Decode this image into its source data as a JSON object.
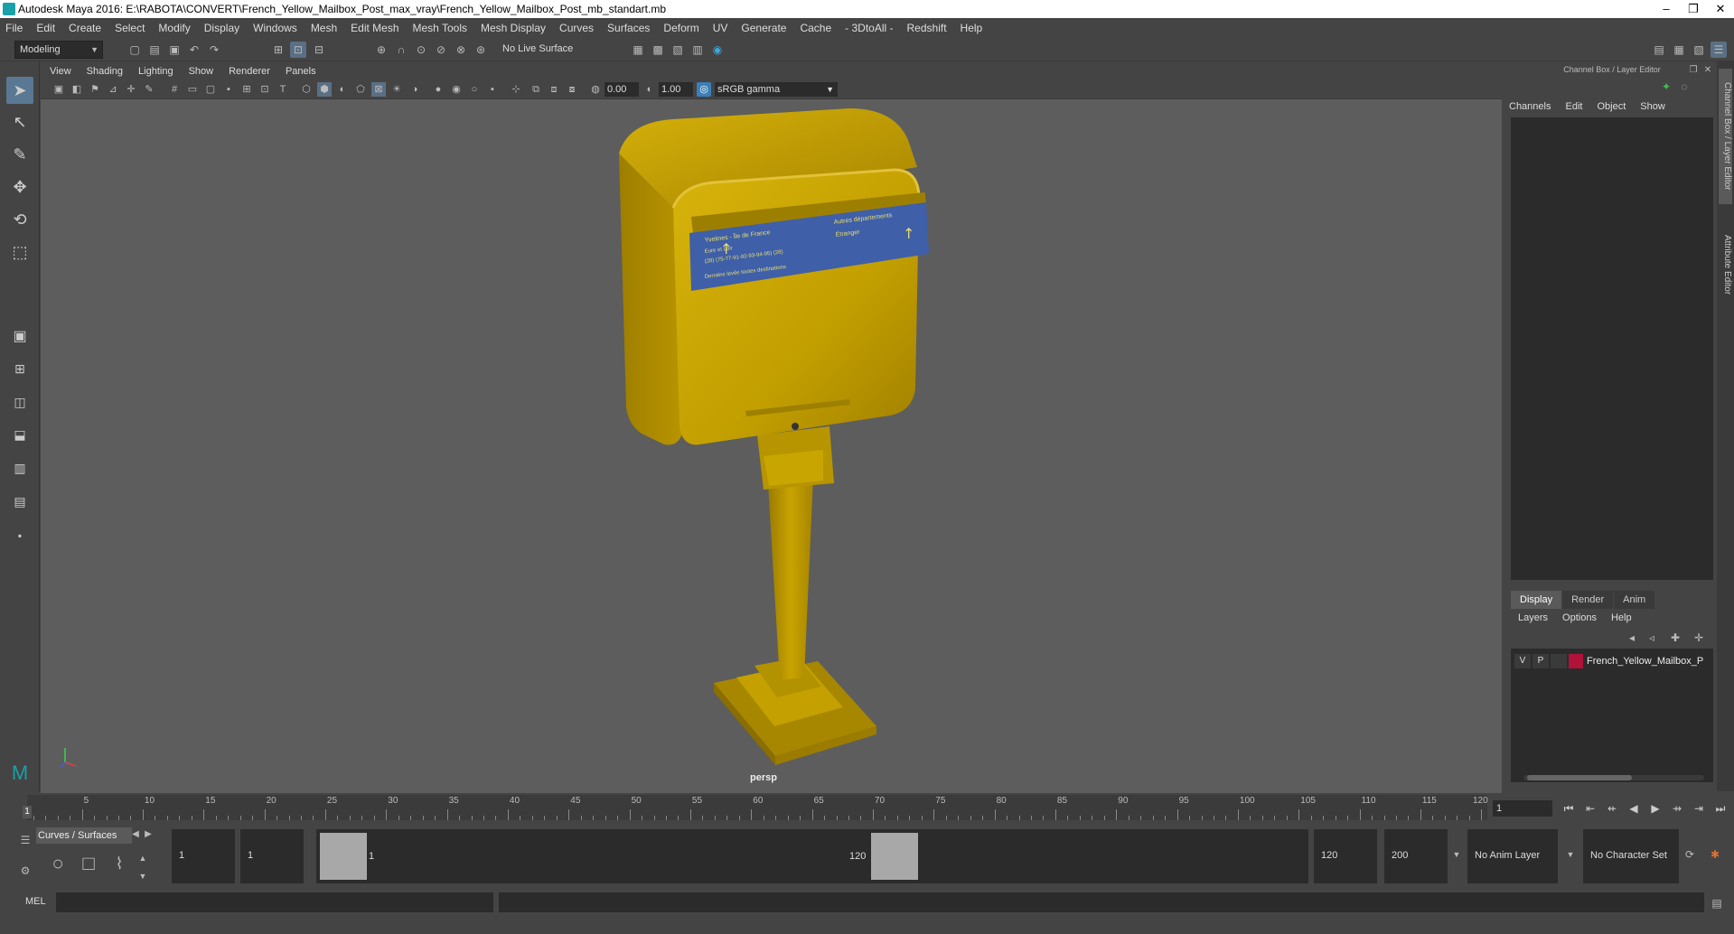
{
  "window": {
    "title": "Autodesk Maya 2016: E:\\RABOTA\\CONVERT\\French_Yellow_Mailbox_Post_max_vray\\French_Yellow_Mailbox_Post_mb_standart.mb",
    "minimize": "–",
    "maximize": "❐",
    "close": "✕"
  },
  "menubar": [
    "File",
    "Edit",
    "Create",
    "Select",
    "Modify",
    "Display",
    "Windows",
    "Mesh",
    "Edit Mesh",
    "Mesh Tools",
    "Mesh Display",
    "Curves",
    "Surfaces",
    "Deform",
    "UV",
    "Generate",
    "Cache",
    "- 3DtoAll -",
    "Redshift",
    "Help"
  ],
  "statusline": {
    "mode": "Modeling",
    "live_surface": "No Live Surface"
  },
  "viewport": {
    "menu": [
      "View",
      "Shading",
      "Lighting",
      "Show",
      "Renderer",
      "Panels"
    ],
    "exposure": "0.00",
    "gamma": "1.00",
    "colorspace": "sRGB gamma",
    "camera": "persp"
  },
  "scene": {
    "sign_lines": [
      "Yvelines - Île de France",
      "Autres départements",
      "Étranger",
      "Eure et Loir",
      "(28) (75-77-91-92-93-94-95) (28)",
      "Dernière levée toutes destinations"
    ],
    "colors": {
      "mailbox": "#c8a400",
      "sign": "#3f5fa8",
      "background": "#5d5d5d"
    }
  },
  "channelbox": {
    "header": "Channel Box / Layer Editor",
    "menu": [
      "Channels",
      "Edit",
      "Object",
      "Show"
    ]
  },
  "layers": {
    "tabs": [
      "Display",
      "Render",
      "Anim"
    ],
    "menu": [
      "Layers",
      "Options",
      "Help"
    ],
    "row": {
      "v": "V",
      "p": "P",
      "name": "French_Yellow_Mailbox_P"
    }
  },
  "sidetabs": [
    "Channel Box / Layer Editor",
    "Attribute Editor"
  ],
  "timeline": {
    "ticks": [
      "5",
      "10",
      "15",
      "20",
      "25",
      "30",
      "35",
      "40",
      "45",
      "50",
      "55",
      "60",
      "65",
      "70",
      "75",
      "80",
      "85",
      "90",
      "95",
      "100",
      "105",
      "110",
      "115",
      "120"
    ],
    "start_label": "1",
    "current_frame": "1"
  },
  "range": {
    "shelf_tab": "Curves / Surfaces",
    "start": "1",
    "playback_start": "1",
    "slider_start": "1",
    "slider_end": "120",
    "playback_end": "120",
    "end": "200",
    "anim_layer": "No Anim Layer",
    "character_set": "No Character Set"
  },
  "mel": {
    "label": "MEL"
  }
}
